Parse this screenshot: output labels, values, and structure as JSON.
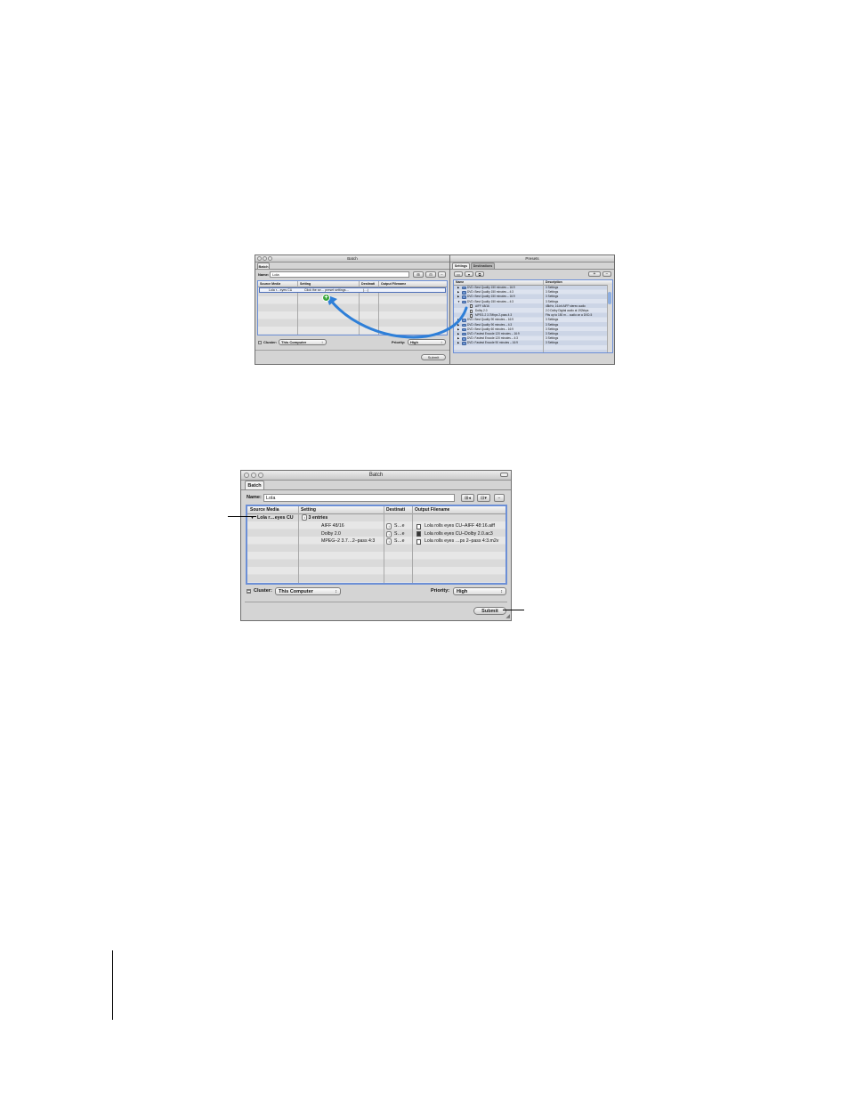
{
  "top_screenshot": {
    "batch_window": {
      "title": "Batch",
      "tab": "Batch",
      "name_label": "Name:",
      "name_value": "Lola",
      "columns": [
        "Source Media",
        "Setting",
        "Destinati",
        "Output Filename"
      ],
      "row": {
        "source": "Lola r…eyes CU",
        "setting": "Click the se… preset settings…",
        "destination": "(…)"
      },
      "drag_badge": "+",
      "cluster_label": "Cluster:",
      "cluster_value": "This Computer",
      "priority_label": "Priority:",
      "priority_value": "High",
      "submit": "Submit"
    },
    "presets_window": {
      "title": "Presets",
      "tabs": [
        "Settings",
        "Destinations"
      ],
      "add_label": "+",
      "remove_label": "−",
      "columns": [
        "Name",
        "Description"
      ],
      "rows": [
        {
          "name": "DVD: Best Quality 150 minutes – 16:9",
          "desc": "3 Settings",
          "kind": "group"
        },
        {
          "name": "DVD: Best Quality 150 minutes – 4:3",
          "desc": "3 Settings",
          "kind": "group"
        },
        {
          "name": "DVD: Best Quality 150 minutes – 16:9",
          "desc": "3 Settings",
          "kind": "group"
        },
        {
          "name": "DVD: Best Quality 150 minutes – 4:3",
          "desc": "3 Settings",
          "kind": "open"
        },
        {
          "name": "AIFF 48/16",
          "desc": "48kHz, 16-bit AIFF stereo audio",
          "kind": "child"
        },
        {
          "name": "Dolby 2.0",
          "desc": "2.0 Dolby Digital audio at 192kbps",
          "kind": "child"
        },
        {
          "name": "MPEG-2 3.7Mbps 2-pass 4:3",
          "desc": "Fits up to 150 m… audio on a DVD-5",
          "kind": "child"
        },
        {
          "name": "DVD: Best Quality 90 minutes – 16:9",
          "desc": "3 Settings",
          "kind": "group"
        },
        {
          "name": "DVD: Best Quality 90 minutes – 4:3",
          "desc": "3 Settings",
          "kind": "group"
        },
        {
          "name": "DVD: Best Quality 60 minutes – 16:9",
          "desc": "3 Settings",
          "kind": "group"
        },
        {
          "name": "DVD: Fastest Encode 120 minutes – 16:9",
          "desc": "3 Settings",
          "kind": "group"
        },
        {
          "name": "DVD: Fastest Encode 120 minutes – 4:3",
          "desc": "3 Settings",
          "kind": "group"
        },
        {
          "name": "DVD: Fastest Encode 90 minutes – 16:9",
          "desc": "3 Settings",
          "kind": "group"
        }
      ]
    }
  },
  "bottom_screenshot": {
    "title": "Batch",
    "tab": "Batch",
    "name_label": "Name:",
    "name_value": "Lola",
    "columns": [
      "Source Media",
      "Setting",
      "Destinati",
      "Output Filename"
    ],
    "source_row": {
      "source": "Lola r…eyes CU",
      "entries": "3 entries"
    },
    "entries": [
      {
        "setting": "AIFF 48/16",
        "dest": "S…e",
        "output": "Lola rolls eyes CU–AIFF 48:16.aiff"
      },
      {
        "setting": "Dolby 2.0",
        "dest": "S…e",
        "output": "Lola rolls eyes CU–Dolby 2.0.ac3"
      },
      {
        "setting": "MPEG–2 3.7…2–pass 4:3",
        "dest": "S…e",
        "output": "Lola rolls eyes …ps 2–pass 4:3.m2v"
      }
    ],
    "cluster_label": "Cluster:",
    "cluster_value": "This Computer",
    "priority_label": "Priority:",
    "priority_value": "High",
    "submit": "Submit"
  },
  "colors": {
    "table_border": "#6c8fd6",
    "drag_arrow": "#2e7fd8",
    "drag_badge": "#3aa63a"
  }
}
